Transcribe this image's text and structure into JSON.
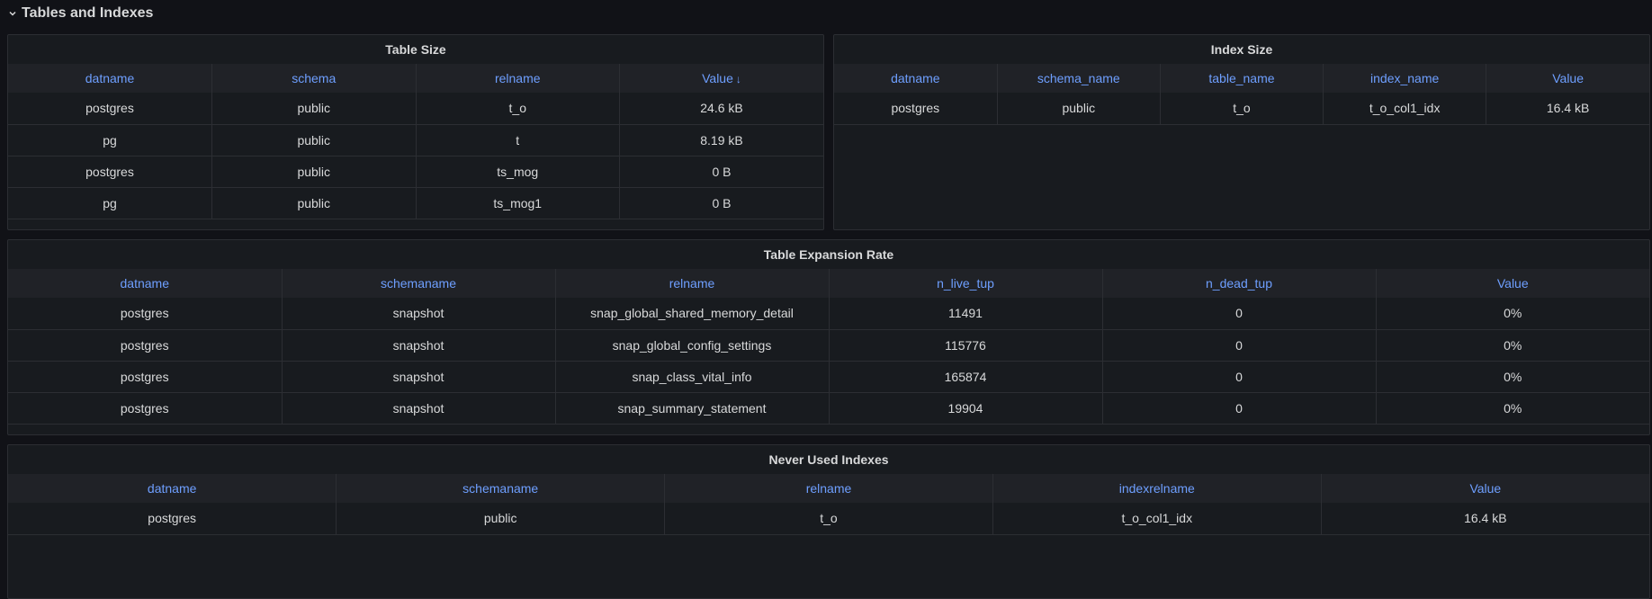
{
  "row": {
    "title": "Tables and Indexes"
  },
  "table_size": {
    "title": "Table Size",
    "columns": [
      "datname",
      "schema",
      "relname",
      "Value"
    ],
    "sort_indicator": "↓",
    "rows": [
      [
        "postgres",
        "public",
        "t_o",
        "24.6 kB"
      ],
      [
        "pg",
        "public",
        "t",
        "8.19 kB"
      ],
      [
        "postgres",
        "public",
        "ts_mog",
        "0 B"
      ],
      [
        "pg",
        "public",
        "ts_mog1",
        "0 B"
      ]
    ]
  },
  "index_size": {
    "title": "Index Size",
    "columns": [
      "datname",
      "schema_name",
      "table_name",
      "index_name",
      "Value"
    ],
    "rows": [
      [
        "postgres",
        "public",
        "t_o",
        "t_o_col1_idx",
        "16.4 kB"
      ]
    ]
  },
  "expansion_rate": {
    "title": "Table Expansion Rate",
    "columns": [
      "datname",
      "schemaname",
      "relname",
      "n_live_tup",
      "n_dead_tup",
      "Value"
    ],
    "rows": [
      [
        "postgres",
        "snapshot",
        "snap_global_shared_memory_detail",
        "11491",
        "0",
        "0%"
      ],
      [
        "postgres",
        "snapshot",
        "snap_global_config_settings",
        "115776",
        "0",
        "0%"
      ],
      [
        "postgres",
        "snapshot",
        "snap_class_vital_info",
        "165874",
        "0",
        "0%"
      ],
      [
        "postgres",
        "snapshot",
        "snap_summary_statement",
        "19904",
        "0",
        "0%"
      ]
    ]
  },
  "never_used": {
    "title": "Never Used Indexes",
    "columns": [
      "datname",
      "schemaname",
      "relname",
      "indexrelname",
      "Value"
    ],
    "rows": [
      [
        "postgres",
        "public",
        "t_o",
        "t_o_col1_idx",
        "16.4 kB"
      ]
    ]
  }
}
